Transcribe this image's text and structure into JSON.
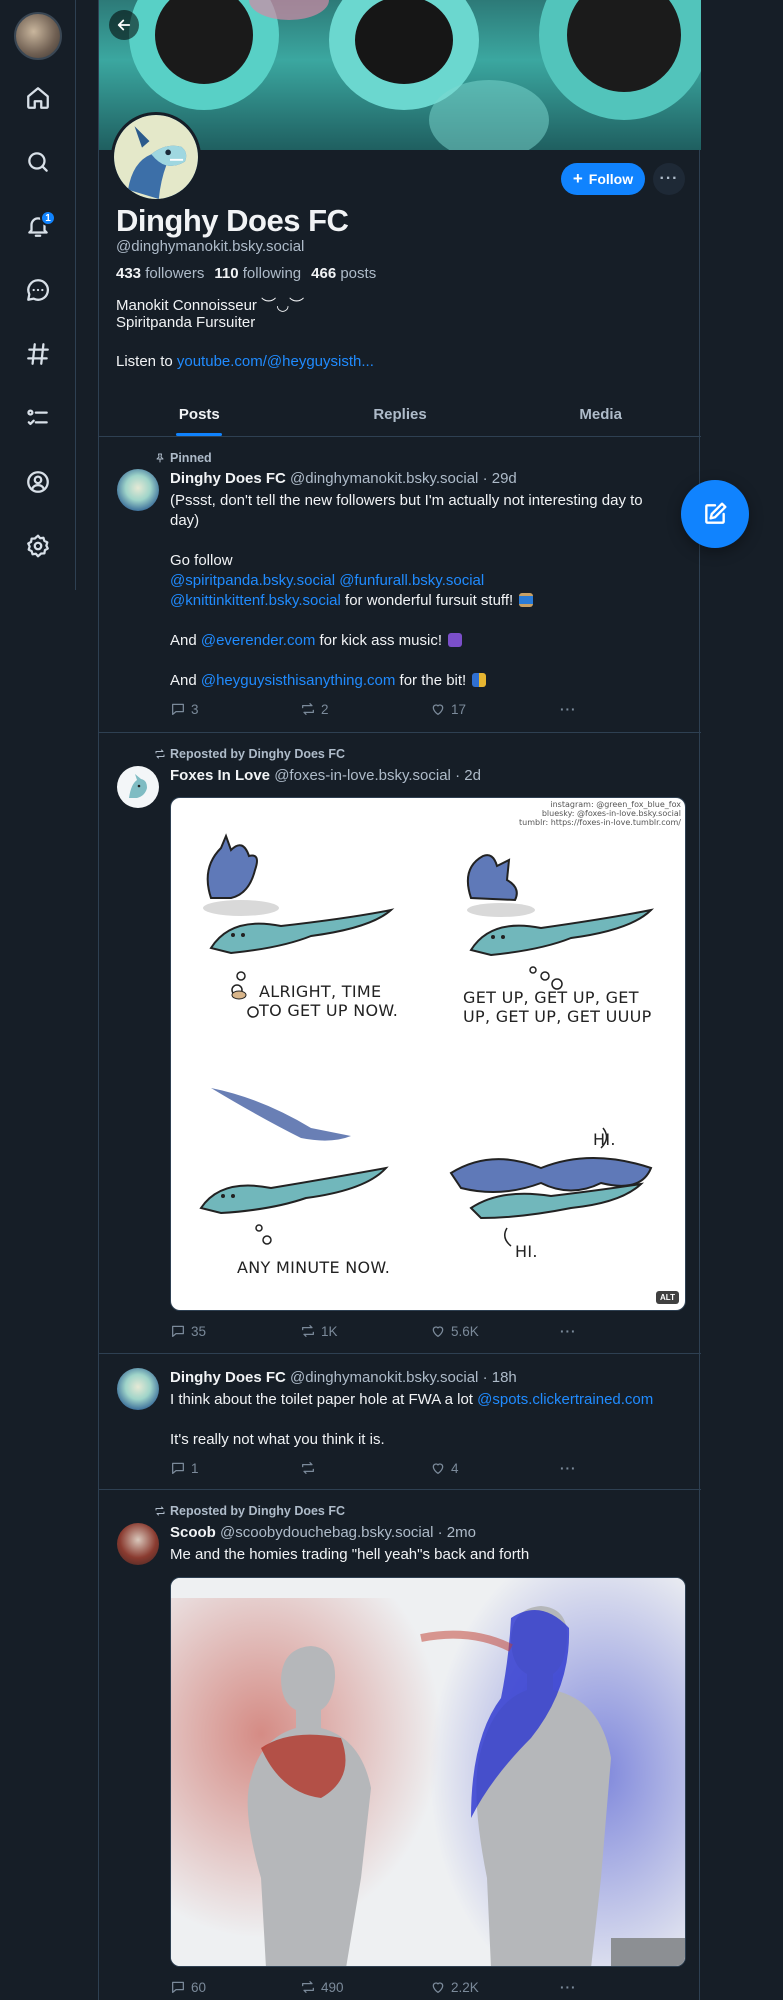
{
  "nav": {
    "items": [
      "home",
      "search",
      "notifications",
      "chat",
      "feeds",
      "lists",
      "profile",
      "settings"
    ],
    "notification_count": "1"
  },
  "profile": {
    "display_name": "Dinghy Does FC",
    "handle": "@dinghymanokit.bsky.social",
    "followers_count": "433",
    "followers_label": "followers",
    "following_count": "110",
    "following_label": "following",
    "posts_count": "466",
    "posts_label": "posts",
    "bio_line1": "Manokit Connoisseur ︶◡︶",
    "bio_line2": "Spiritpanda Fursuiter",
    "bio_link_prefix": "Listen to ",
    "bio_link": "youtube.com/@heyguysisth...",
    "follow_label": "Follow",
    "more_label": "···"
  },
  "tabs": [
    {
      "label": "Posts",
      "active": true
    },
    {
      "label": "Replies",
      "active": false
    },
    {
      "label": "Media",
      "active": false
    }
  ],
  "posts": [
    {
      "meta": "Pinned",
      "author": "Dinghy Does FC",
      "handle": "@dinghymanokit.bsky.social",
      "time": "· 29d",
      "line1": "(Pssst, don't tell the new followers but I'm actually not interesting day to",
      "line2": "day)",
      "line3": "Go follow",
      "mention1": "@spiritpanda.bsky.social",
      "mention2": "@funfurall.bsky.social",
      "mention3": "@knittinkittenf.bsky.social",
      "line4_suffix": " for wonderful fursuit stuff!",
      "line5_prefix": "And ",
      "mention4": "@everender.com",
      "line5_suffix": " for kick ass music!",
      "line6_prefix": "And ",
      "mention5": "@heyguysisthisanything.com",
      "line6_suffix": " for the bit!",
      "replies": "3",
      "reposts": "2",
      "likes": "17"
    },
    {
      "meta": "Reposted by Dinghy Does FC",
      "author": "Foxes In Love",
      "handle": "@foxes-in-love.bsky.social",
      "time": "· 2d",
      "comic_credit": [
        "instagram: @green_fox_blue_fox",
        "bluesky: @foxes-in-love.bsky.social",
        "tumblr: https://foxes-in-love.tumblr.com/"
      ],
      "panel1_caption": [
        "ALRIGHT, TIME",
        "TO GET UP NOW."
      ],
      "panel2_caption": [
        "GET UP, GET UP, GET",
        "UP, GET UP, GET UUUP"
      ],
      "panel3_caption": "ANY MINUTE NOW.",
      "panel4_hi_top": "HI.",
      "panel4_hi_bottom": "HI.",
      "alt_badge": "ALT",
      "replies": "35",
      "reposts": "1K",
      "likes": "5.6K"
    },
    {
      "author": "Dinghy Does FC",
      "handle": "@dinghymanokit.bsky.social",
      "time": "· 18h",
      "line1_prefix": "I think about the toilet paper hole at FWA a lot ",
      "mention1": "@spots.clickertrained.com",
      "line2": "It's really not what you think it is.",
      "replies": "1",
      "reposts": "",
      "likes": "4"
    },
    {
      "meta": "Reposted by Dinghy Does FC",
      "author": "Scoob",
      "handle": "@scoobydouchebag.bsky.social",
      "time": "· 2mo",
      "line1": "Me and the homies trading \"hell yeah\"s back and forth",
      "replies": "60",
      "reposts": "490",
      "likes": "2.2K"
    }
  ],
  "colors": {
    "background": "#161e27",
    "accent": "#1083fe",
    "link": "#208bfe",
    "muted": "#aebbc9"
  }
}
